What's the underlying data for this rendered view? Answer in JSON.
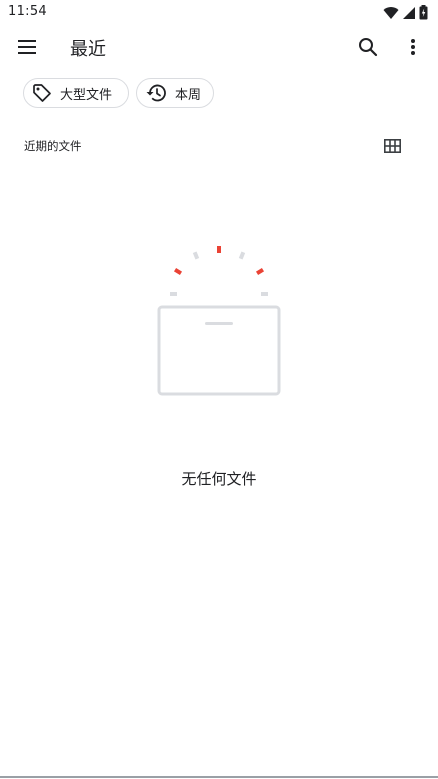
{
  "status_bar": {
    "time": "11:54",
    "icons": [
      "wifi-icon",
      "cellular-signal-icon",
      "battery-icon"
    ]
  },
  "app_bar": {
    "title": "最近",
    "menu_icon": "hamburger-menu-icon",
    "search_icon": "search-icon",
    "overflow_icon": "more-vert-icon"
  },
  "chips": [
    {
      "label": "大型文件",
      "icon": "tag-icon"
    },
    {
      "label": "本周",
      "icon": "history-icon"
    }
  ],
  "section": {
    "title": "近期的文件",
    "view_toggle_icon": "grid-view-icon"
  },
  "empty_state": {
    "message": "无任何文件",
    "illustration": "empty-folder-illustration"
  },
  "colors": {
    "accent_red": "#ea4335",
    "illustration_gray": "#dadce0",
    "text": "#202124"
  }
}
